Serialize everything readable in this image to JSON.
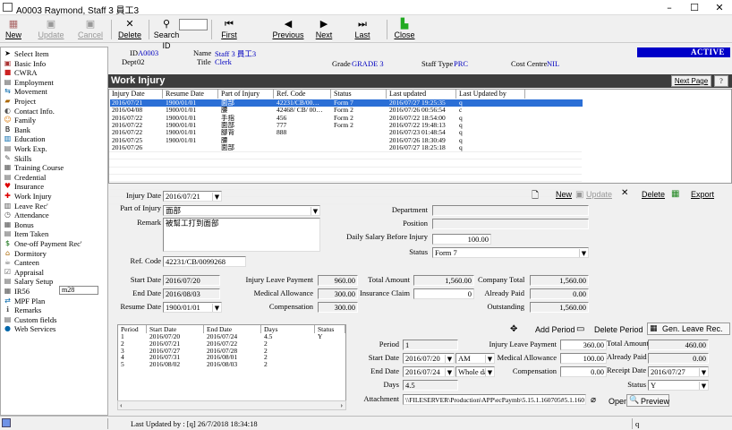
{
  "window": {
    "title": "A0003 Raymond, Staff 3 員工3"
  },
  "toolbar": {
    "new": "New",
    "update": "Update",
    "cancel": "Cancel",
    "delete": "Delete",
    "search_id": "Search ID",
    "first": "First",
    "previous": "Previous",
    "next": "Next",
    "last": "Last",
    "close": "Close"
  },
  "sidebar": {
    "items": [
      "Select Item",
      "Basic Info",
      "CWRA",
      "Employment",
      "Movement",
      "Project",
      "Contact Info.",
      "Family",
      "Bank",
      "Education",
      "Work Exp.",
      "Skills",
      "Training Course",
      "Credential",
      "Insurance",
      "Work Injury",
      "Leave Rec'",
      "Attendance",
      "Bonus",
      "Item Taken",
      "One-off Payment Rec'",
      "Dormitory",
      "Canteen",
      "Appraisal",
      "Salary Setup",
      "IR56",
      "MPF Plan",
      "Remarks",
      "Custom fields",
      "Web Services"
    ],
    "mpf_input": "m28"
  },
  "header": {
    "id_label": "ID",
    "id_value": "A0003",
    "dept_label": "Dept",
    "dept_value": "02",
    "name_label": "Name",
    "name_value": "Staff 3 員工3",
    "title_label": "Title",
    "title_value": "Clerk",
    "grade_label": "Grade",
    "grade_value": "GRADE 3",
    "staff_type_label": "Staff Type",
    "staff_type_value": "PRC",
    "cost_centre_label": "Cost Centre",
    "cost_centre_value": "NIL",
    "status": "ACTIVE"
  },
  "section": {
    "title": "Work Injury",
    "next_page": "Next Page",
    "help": "?"
  },
  "grid": {
    "columns": [
      "Injury Date",
      "Resume Date",
      "Part of Injury",
      "Ref. Code",
      "Status",
      "Last updated",
      "Last Updated by"
    ],
    "rows": [
      [
        "2016/07/21",
        "1900/01/01",
        "面部",
        "42231/CB/00…",
        "Form 7",
        "2016/07/27 19:25:35",
        "q"
      ],
      [
        "2016/04/08",
        "1900/01/01",
        "腰",
        "42468/ CB/ 00…",
        "Form 2",
        "2016/07/26 00:56:54",
        "c"
      ],
      [
        "2016/07/22",
        "1900/01/01",
        "手指",
        "456",
        "Form 2",
        "2016/07/22 18:54:00",
        "q"
      ],
      [
        "2016/07/22",
        "1900/01/01",
        "面部",
        "777",
        "Form 2",
        "2016/07/22 19:48:13",
        "q"
      ],
      [
        "2016/07/22",
        "1900/01/01",
        "腳背",
        "888",
        "",
        "2016/07/23 01:48:54",
        "q"
      ],
      [
        "2016/07/25",
        "1900/01/01",
        "腰",
        "",
        "",
        "2016/07/26 18:30:49",
        "q"
      ],
      [
        "2016/07/26",
        "",
        "面部",
        "",
        "",
        "2016/07/27 18:25:18",
        "q"
      ]
    ]
  },
  "form": {
    "injury_date_label": "Injury Date",
    "injury_date": "2016/07/21",
    "part_label": "Part of Injury",
    "part": "面部",
    "remark_label": "Remark",
    "remark": "被幫工打到面部",
    "ref_label": "Ref. Code",
    "ref": "42231/CB/0099268",
    "department_label": "Department",
    "department": "",
    "position_label": "Position",
    "position": "",
    "daily_salary_label": "Daily Salary Before Injury",
    "daily_salary": "100.00",
    "status_label": "Status",
    "status": "Form 7",
    "new": "New",
    "update": "Update",
    "delete": "Delete",
    "export": "Export",
    "start_date_label": "Start Date",
    "start_date": "2016/07/20",
    "end_date_label": "End Date",
    "end_date": "2016/08/03",
    "resume_date_label": "Resume Date",
    "resume_date": "1900/01/01",
    "injury_leave_payment_label": "Injury Leave Payment",
    "injury_leave_payment": "960.00",
    "medical_allowance_label": "Medical Allowance",
    "medical_allowance": "300.00",
    "compensation_label": "Compensation",
    "compensation": "300.00",
    "total_amount_label": "Total Amount",
    "total_amount": "1,560.00",
    "insurance_claim_label": "Insurance Claim",
    "insurance_claim": "0",
    "company_total_label": "Company Total",
    "company_total": "1,560.00",
    "already_paid_label": "Already Paid",
    "already_paid": "0.00",
    "outstanding_label": "Outstanding",
    "outstanding": "1,560.00"
  },
  "periods": {
    "columns": [
      "Period",
      "Start Date",
      "End Date",
      "Days",
      "Status"
    ],
    "rows": [
      [
        "1",
        "2016/07/20",
        "2016/07/24",
        "4.5",
        "Y"
      ],
      [
        "2",
        "2016/07/21",
        "2016/07/22",
        "2",
        ""
      ],
      [
        "3",
        "2016/07/27",
        "2016/07/28",
        "2",
        ""
      ],
      [
        "4",
        "2016/07/31",
        "2016/08/01",
        "2",
        ""
      ],
      [
        "5",
        "2016/08/02",
        "2016/08/03",
        "2",
        ""
      ]
    ]
  },
  "period_detail": {
    "add_period": "Add Period",
    "delete_period": "Delete Period",
    "gen_leave": "Gen. Leave Rec.",
    "period_label": "Period",
    "period": "1",
    "start_date_label": "Start Date",
    "start_date": "2016/07/20",
    "start_ampm": "AM",
    "end_date_label": "End Date",
    "end_date": "2016/07/24",
    "end_ampm": "Whole day",
    "days_label": "Days",
    "days": "4.5",
    "injury_leave_payment_label": "Injury Leave Payment",
    "injury_leave_payment": "360.00",
    "total_amount_label": "Total Amount",
    "total_amount": "460.00",
    "medical_allowance_label": "Medical Allowance",
    "medical_allowance": "100.00",
    "already_paid_label": "Already Paid",
    "already_paid": "0.00",
    "compensation_label": "Compensation",
    "compensation": "0.00",
    "receipt_date_label": "Receipt Date",
    "receipt_date": "2016/07/27",
    "status_label": "Status",
    "status": "Y",
    "attachment_label": "Attachment",
    "attachment": "\\\\FILESERVER\\Production\\APP\\ecPaymb\\5.15.1.160705#5.1.160",
    "open": "Open",
    "preview": "Preview"
  },
  "statusbar": {
    "last_updated": "Last Updated by : [q] 26/7/2018 18:34:18",
    "user": "q"
  }
}
